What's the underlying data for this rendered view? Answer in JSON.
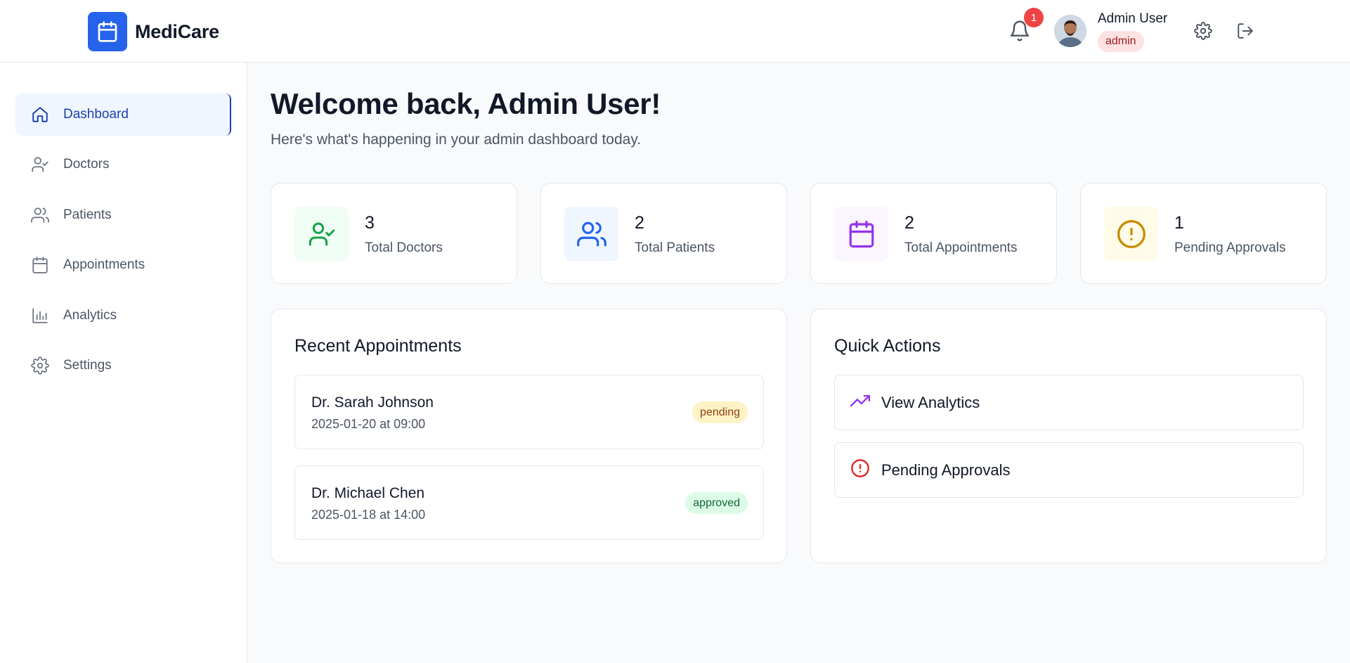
{
  "app": {
    "name": "MediCare"
  },
  "header": {
    "notification_count": "1",
    "user_name": "Admin User",
    "user_role": "admin"
  },
  "sidebar": {
    "items": [
      {
        "label": "Dashboard",
        "icon": "home-icon",
        "active": true
      },
      {
        "label": "Doctors",
        "icon": "user-check-icon"
      },
      {
        "label": "Patients",
        "icon": "users-icon"
      },
      {
        "label": "Appointments",
        "icon": "calendar-icon"
      },
      {
        "label": "Analytics",
        "icon": "bar-chart-icon"
      },
      {
        "label": "Settings",
        "icon": "gear-icon"
      }
    ]
  },
  "main": {
    "welcome": "Welcome back, Admin User!",
    "subtitle": "Here's what's happening in your admin dashboard today.",
    "stats": [
      {
        "value": "3",
        "label": "Total Doctors",
        "icon": "user-check-icon",
        "color": "#16a34a",
        "bg": "#f0fdf4"
      },
      {
        "value": "2",
        "label": "Total Patients",
        "icon": "users-icon",
        "color": "#2563eb",
        "bg": "#eff6ff"
      },
      {
        "value": "2",
        "label": "Total Appointments",
        "icon": "calendar-icon",
        "color": "#9333ea",
        "bg": "#faf5ff"
      },
      {
        "value": "1",
        "label": "Pending Approvals",
        "icon": "alert-circle-icon",
        "color": "#ca8a04",
        "bg": "#fefce8"
      }
    ],
    "recent_appointments": {
      "title": "Recent Appointments",
      "items": [
        {
          "doctor": "Dr. Sarah Johnson",
          "when": "2025-01-20 at 09:00",
          "status": "pending"
        },
        {
          "doctor": "Dr. Michael Chen",
          "when": "2025-01-18 at 14:00",
          "status": "approved"
        }
      ]
    },
    "quick_actions": {
      "title": "Quick Actions",
      "items": [
        {
          "label": "View Analytics",
          "icon": "trending-up-icon",
          "color": "#9333ea"
        },
        {
          "label": "Pending Approvals",
          "icon": "alert-circle-icon",
          "color": "#dc2626"
        }
      ]
    }
  },
  "colors": {
    "primary": "#2563eb",
    "active_nav_bg": "#eff6ff",
    "active_nav_text": "#1e40af",
    "badge_red": "#ef4444"
  }
}
